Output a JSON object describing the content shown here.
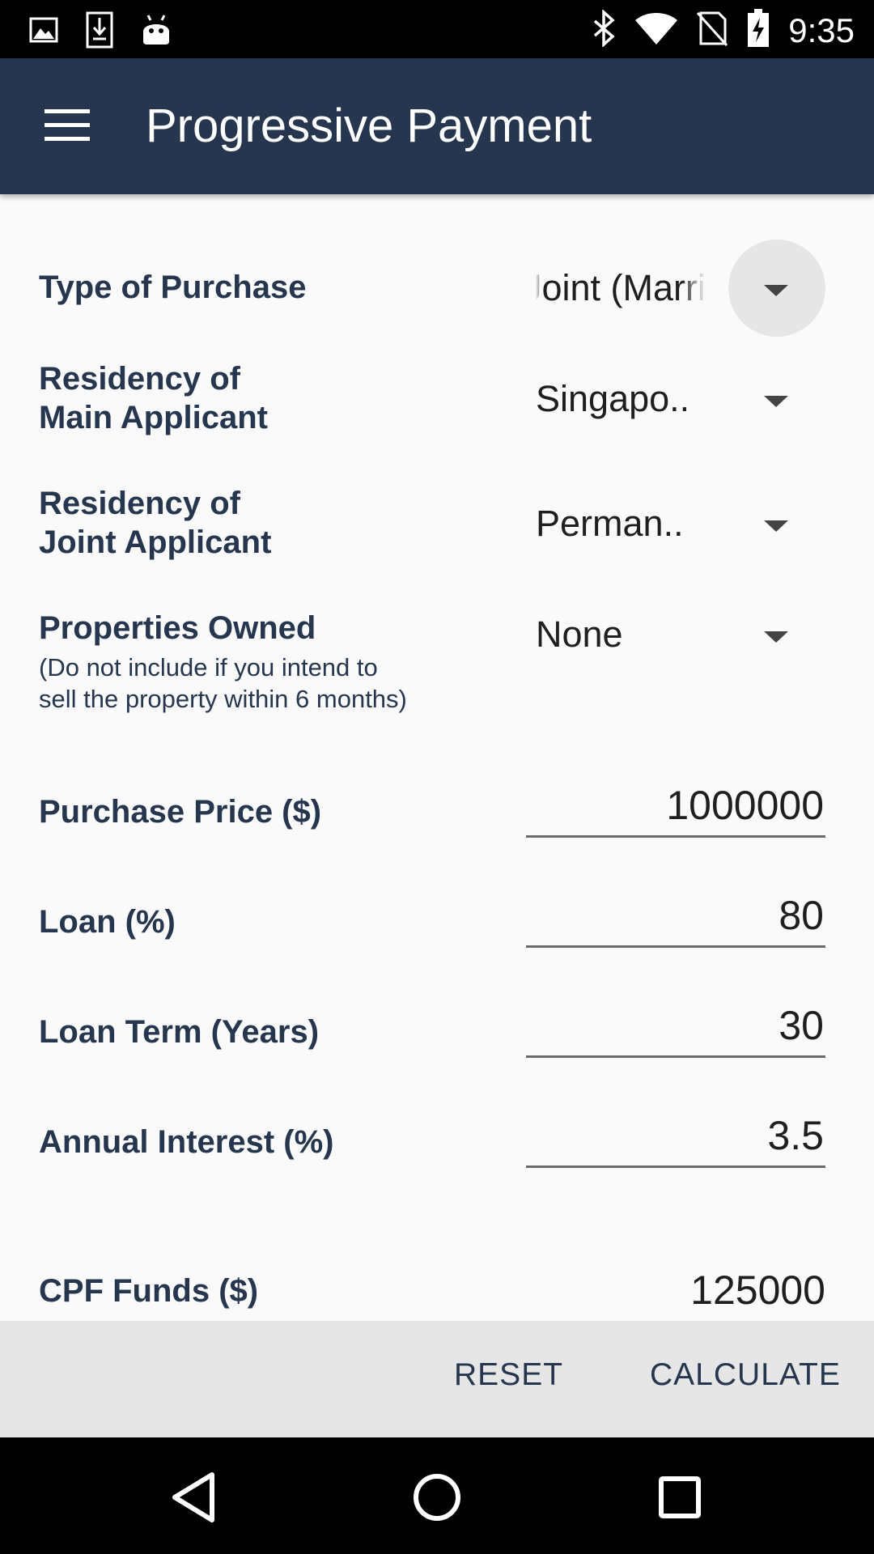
{
  "status_bar": {
    "time": "9:35",
    "left_icons": [
      "image-icon",
      "download-icon",
      "android-icon"
    ],
    "right_icons": [
      "bluetooth-icon",
      "wifi-icon",
      "no-sim-icon",
      "battery-charging-icon"
    ]
  },
  "app_bar": {
    "title": "Progressive Payment",
    "menu_icon": "menu-icon"
  },
  "form": {
    "type_of_purchase": {
      "label": "Type of Purchase",
      "value": "Joint (Marri"
    },
    "residency_main": {
      "label_line1": "Residency of",
      "label_line2": "Main Applicant",
      "value": "Singapo.."
    },
    "residency_joint": {
      "label_line1": "Residency of",
      "label_line2": "Joint Applicant",
      "value": "Perman.."
    },
    "properties_owned": {
      "label": "Properties Owned",
      "note_line1": "(Do not include if you intend to",
      "note_line2": "sell the property within 6 months)",
      "value": "None"
    },
    "purchase_price": {
      "label": "Purchase Price ($)",
      "value": "1000000"
    },
    "loan": {
      "label": "Loan (%)",
      "value": "80"
    },
    "loan_term": {
      "label": "Loan Term (Years)",
      "value": "30"
    },
    "annual_interest": {
      "label": "Annual Interest (%)",
      "value": "3.5"
    },
    "cpf_funds": {
      "label": "CPF Funds ($)",
      "value": "125000"
    }
  },
  "actions": {
    "reset_label": "RESET",
    "calculate_label": "CALCULATE"
  },
  "nav_bar": {
    "buttons": [
      "back-icon",
      "home-icon",
      "recents-icon"
    ]
  },
  "colors": {
    "app_bar": "#26364e",
    "label_text": "#26364e",
    "background": "#fafafa",
    "action_bar": "#e6e6e6"
  }
}
